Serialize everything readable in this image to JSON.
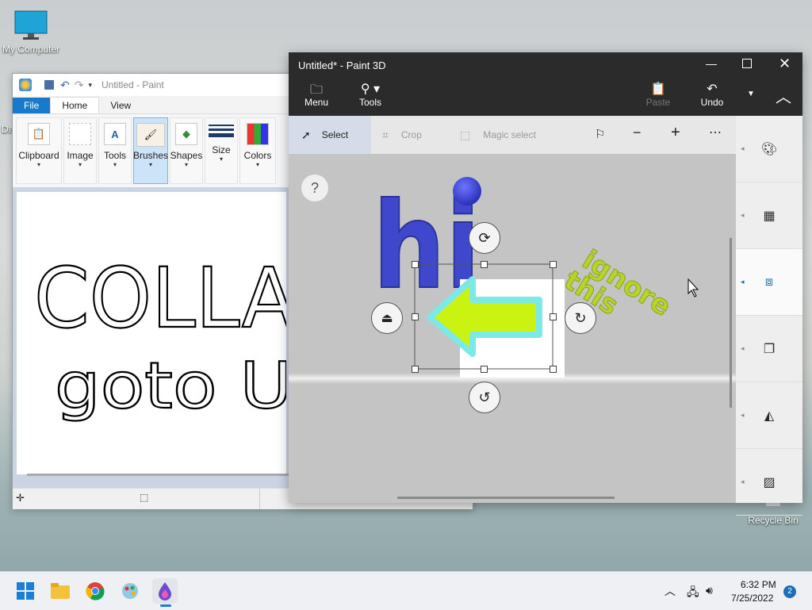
{
  "desktop": {
    "icons": [
      {
        "label": "My Computer",
        "icon": "monitor-icon"
      },
      {
        "label": "Recycle Bin",
        "icon": "recycle-bin-icon"
      }
    ],
    "partial_icon_label": "Da"
  },
  "paint": {
    "title": "Untitled - Paint",
    "tabs": [
      "File",
      "Home",
      "View"
    ],
    "ribbon": [
      {
        "label": "Clipboard",
        "icon": "clipboard-icon"
      },
      {
        "label": "Image",
        "icon": "image-select-icon"
      },
      {
        "label": "Tools",
        "icon": "tools-icon"
      },
      {
        "label": "Brushes",
        "icon": "brush-icon",
        "selected": true
      },
      {
        "label": "Shapes",
        "icon": "shapes-icon"
      },
      {
        "label": "Size",
        "icon": "size-lines-icon"
      },
      {
        "label": "Colors",
        "icon": "colors-icon"
      }
    ],
    "canvas_text_line1": "COLLA",
    "canvas_text_line2": "goto U"
  },
  "paint3d": {
    "title": "Untitled* - Paint 3D",
    "window_controls": [
      "minimize",
      "maximize",
      "close"
    ],
    "commands": {
      "menu": "Menu",
      "tools": "Tools",
      "paste": "Paste",
      "undo": "Undo"
    },
    "toolbar": {
      "select": "Select",
      "crop": "Crop",
      "magic_select": "Magic select"
    },
    "help": "?",
    "canvas_text_hi": "hi",
    "canvas_text_ignore": "ignore",
    "canvas_text_this": "this",
    "sidebar_icons": [
      "palette-icon",
      "grid-icon",
      "selection-box-icon",
      "copy-icon",
      "mirror-icon",
      "hatch-icon"
    ]
  },
  "taskbar": {
    "apps": [
      "windows-start-icon",
      "file-explorer-icon",
      "chrome-icon",
      "paint-icon",
      "paint3d-icon"
    ],
    "time": "6:32 PM",
    "date": "7/25/2022",
    "notification_count": "2"
  },
  "colors": {
    "paint3d_dark": "#2b2b2b",
    "file_tab": "#1979ca",
    "letters_blue": "#3f47cc",
    "arrow_lime": "#cbf312",
    "arrow_cyan": "#7de8e8",
    "ignore_text": "#b6d42a"
  }
}
